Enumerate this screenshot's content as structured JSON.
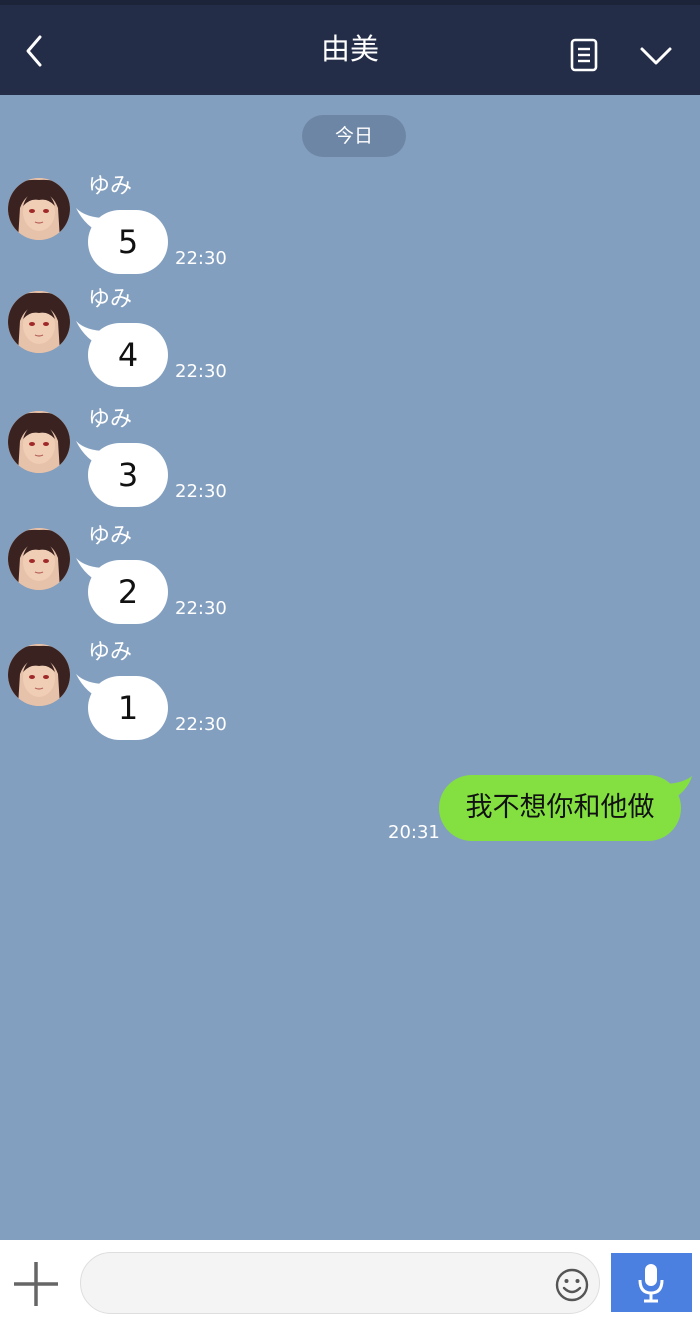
{
  "header": {
    "title": "由美",
    "back_icon": "chevron-left-icon",
    "notes_icon": "notes-icon",
    "menu_icon": "chevron-down-icon"
  },
  "date_separator": "今日",
  "messages": [
    {
      "sender": "ゆみ",
      "text": "5",
      "time": "22:30"
    },
    {
      "sender": "ゆみ",
      "text": "4",
      "time": "22:30"
    },
    {
      "sender": "ゆみ",
      "text": "3",
      "time": "22:30"
    },
    {
      "sender": "ゆみ",
      "text": "2",
      "time": "22:30"
    },
    {
      "sender": "ゆみ",
      "text": "1",
      "time": "22:30"
    }
  ],
  "outgoing": {
    "text": "我不想你和他做",
    "time": "20:31"
  },
  "input": {
    "value": "",
    "plus_icon": "plus-icon",
    "emoji_icon": "smile-icon",
    "mic_icon": "microphone-icon"
  },
  "colors": {
    "header_bg": "#232d48",
    "chat_bg": "#839fbf",
    "incoming_bubble": "#ffffff",
    "outgoing_bubble": "#84e040",
    "mic_button": "#4b7fe0"
  }
}
